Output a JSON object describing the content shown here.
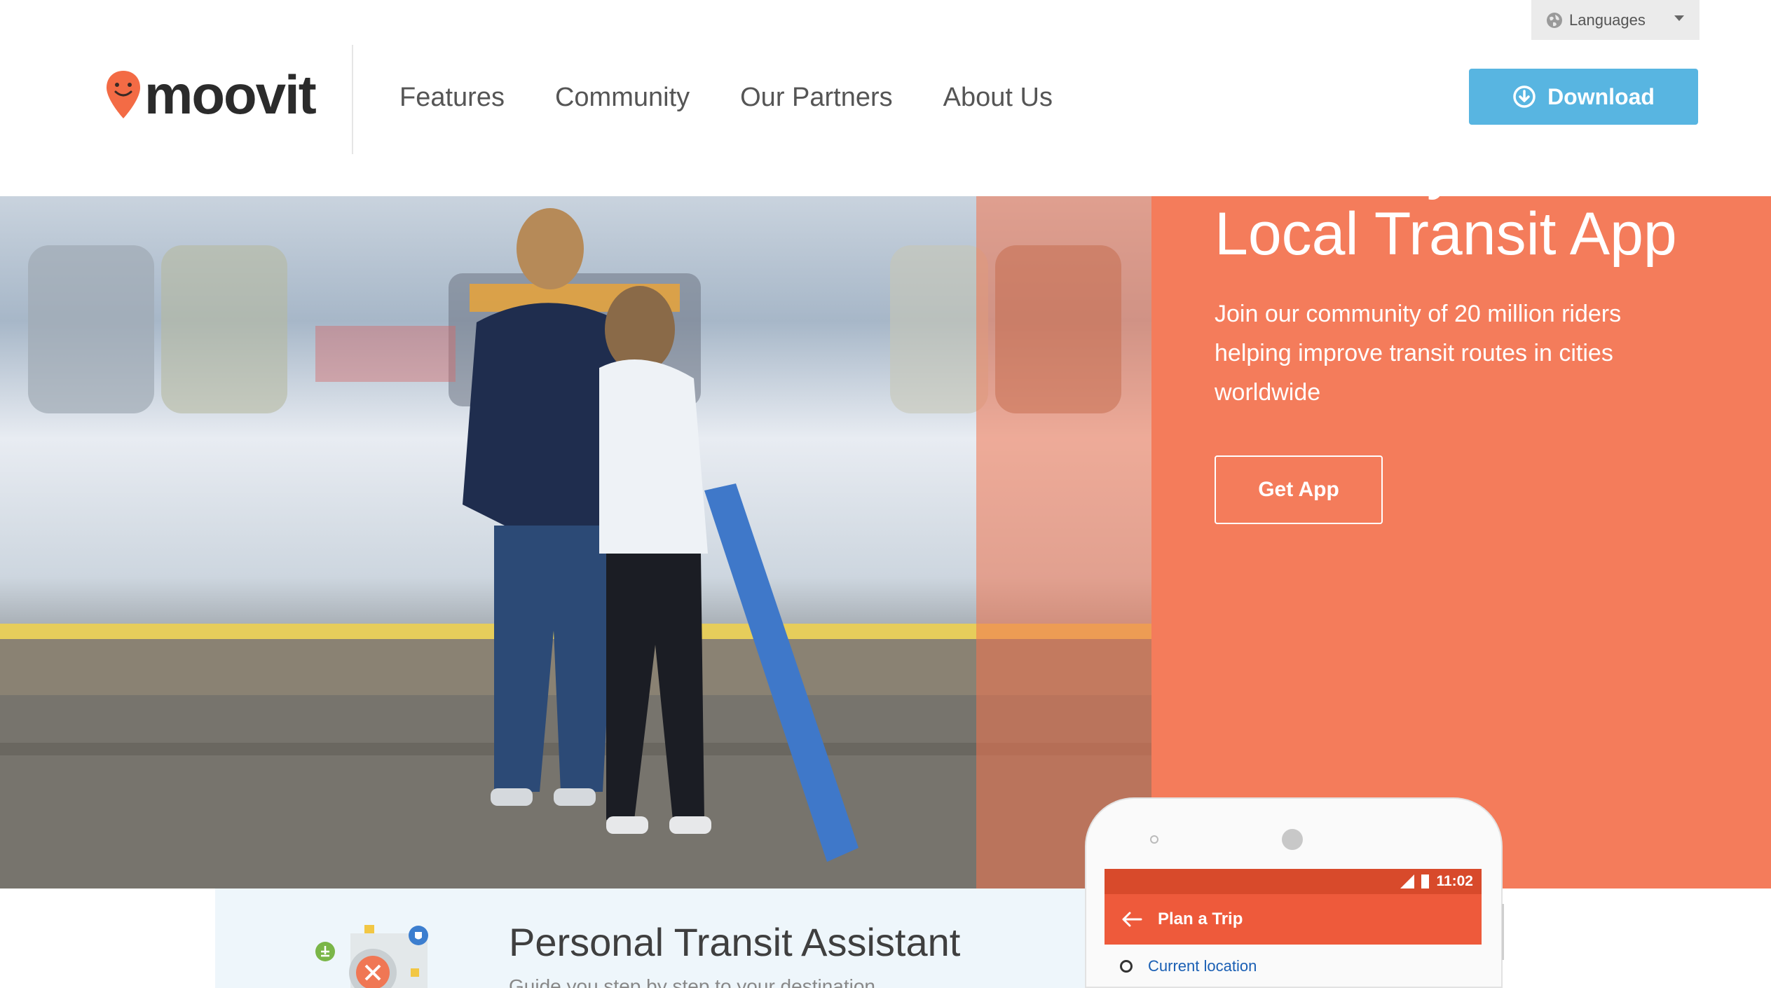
{
  "header": {
    "languages_label": "Languages",
    "logo_text": "moovit",
    "nav": [
      "Features",
      "Community",
      "Our Partners",
      "About Us"
    ],
    "download_label": "Download"
  },
  "hero": {
    "title_line1": "Your City, Your",
    "title_line2": "Local Transit App",
    "subtitle": "Join our community of 20 million riders helping improve transit routes in cities worldwide",
    "cta_label": "Get App"
  },
  "feature": {
    "title": "Personal Transit Assistant",
    "subtitle": "Guide you step by step to your destination"
  },
  "phone": {
    "time": "11:02",
    "appbar_title": "Plan a Trip",
    "row_label": "Current location"
  },
  "colors": {
    "brand_orange": "#f47c5b",
    "download_blue": "#58b5e1",
    "appbar_red": "#ee5a3b"
  }
}
